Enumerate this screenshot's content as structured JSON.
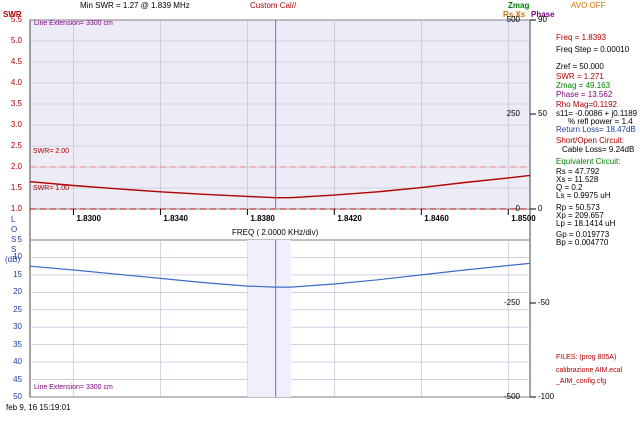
{
  "header": {
    "swr_axis_label": "SWR",
    "min_swr": "Min SWR =   1.27 @  1.839 MHz",
    "title": "Custom Cal//",
    "zmag": "Zmag",
    "rsxs": "Rs,Xs",
    "phase": "Phase",
    "avo": "AVO OFF"
  },
  "swr_axis": [
    "5.5",
    "5.0",
    "4.5",
    "4.0",
    "3.5",
    "3.0",
    "2.5",
    "2.0",
    "1.5",
    "1.0"
  ],
  "loss_axis": [
    "5",
    "10",
    "15",
    "20",
    "25",
    "30",
    "35",
    "40",
    "45",
    "50"
  ],
  "loss_label": [
    "L",
    "O",
    "S",
    "S",
    "(dB)"
  ],
  "right_axis_zmag": [
    "500",
    "250",
    "0",
    "-250",
    "-500"
  ],
  "right_axis_phase": [
    "90",
    "50",
    "0",
    "-50",
    "-100"
  ],
  "freq_ticks": [
    "1.8300",
    "1.8340",
    "1.8380",
    "1.8420",
    "1.8460",
    "1.8500"
  ],
  "freq_label": "FREQ (   2.0000 KHz/div)",
  "line_ext_top": "Line Extension= 3300 cm",
  "line_ext_bottom": "Line Extension= 3300 cm",
  "swr_ref_high": "SWR= 2.00",
  "swr_ref_low": "SWR= 1.00",
  "timestamp": "feb 9, 16  15:19:01",
  "readouts": {
    "freq": "Freq = 1.8393",
    "freq_step": "Freq Step = 0.00010",
    "zref": "Zref =   50.000",
    "swr": "SWR  =   1.271",
    "zmag": "Zmag =  49.163",
    "phase": "Phase =  13.562",
    "rho": "Rho Mag=0.1192",
    "s11": "s11= -0.0086 + j0.1189",
    "refl": "% refl power =  1.4",
    "return_loss": "Return Loss= 18.47dB",
    "short_open": "Short/Open Circuit:",
    "cable_loss": "Cable Loss=  9.24dB",
    "equiv": "Equivalent Circuit:",
    "rs": "Rs =   47.792",
    "xs": "Xs =   11.528",
    "q": "Q =  0.2",
    "ls": "Ls =    0.9975 uH",
    "rp": "Rp =   50.573",
    "xp": "Xp =  209.657",
    "lp": "Lp =   18.1414  uH",
    "gp": "Gp =   0.019773",
    "bp": "Bp =   0.004770",
    "files": "FILES:  (prog 805A)",
    "file1": "calibrazione AIM.ecal",
    "file2": "_AIM_config.cfg"
  },
  "colors": {
    "swr_curve": "#b00000",
    "loss_curve": "#3c6cc8",
    "grid": "#b8b8d0",
    "cursor": "#6a6aff",
    "plot_bg": "#ecebf6"
  },
  "chart_data": {
    "type": "line",
    "title": "Custom Cal//",
    "xlabel": "FREQ (   2.0000 KHz/div)",
    "x": [
      1.828,
      1.83,
      1.832,
      1.834,
      1.836,
      1.838,
      1.8393,
      1.84,
      1.842,
      1.844,
      1.846,
      1.848,
      1.85,
      1.851
    ],
    "xlim": [
      1.828,
      1.851
    ],
    "series": [
      {
        "axis": "SWR",
        "ylim": [
          1.0,
          5.5
        ],
        "values": [
          1.65,
          1.56,
          1.48,
          1.41,
          1.35,
          1.3,
          1.27,
          1.27,
          1.33,
          1.41,
          1.51,
          1.63,
          1.74,
          1.8
        ]
      },
      {
        "axis": "LOSS (dB)",
        "ylim": [
          50,
          5
        ],
        "values": [
          12.5,
          13.6,
          14.8,
          16.0,
          17.2,
          18.2,
          18.5,
          18.5,
          17.6,
          16.4,
          15.0,
          13.6,
          12.3,
          11.7
        ]
      }
    ],
    "reference_lines": [
      {
        "label": "SWR= 2.00",
        "value": 2.0
      },
      {
        "label": "SWR= 1.00",
        "value": 1.0
      }
    ],
    "cursor_x": 1.8393
  }
}
